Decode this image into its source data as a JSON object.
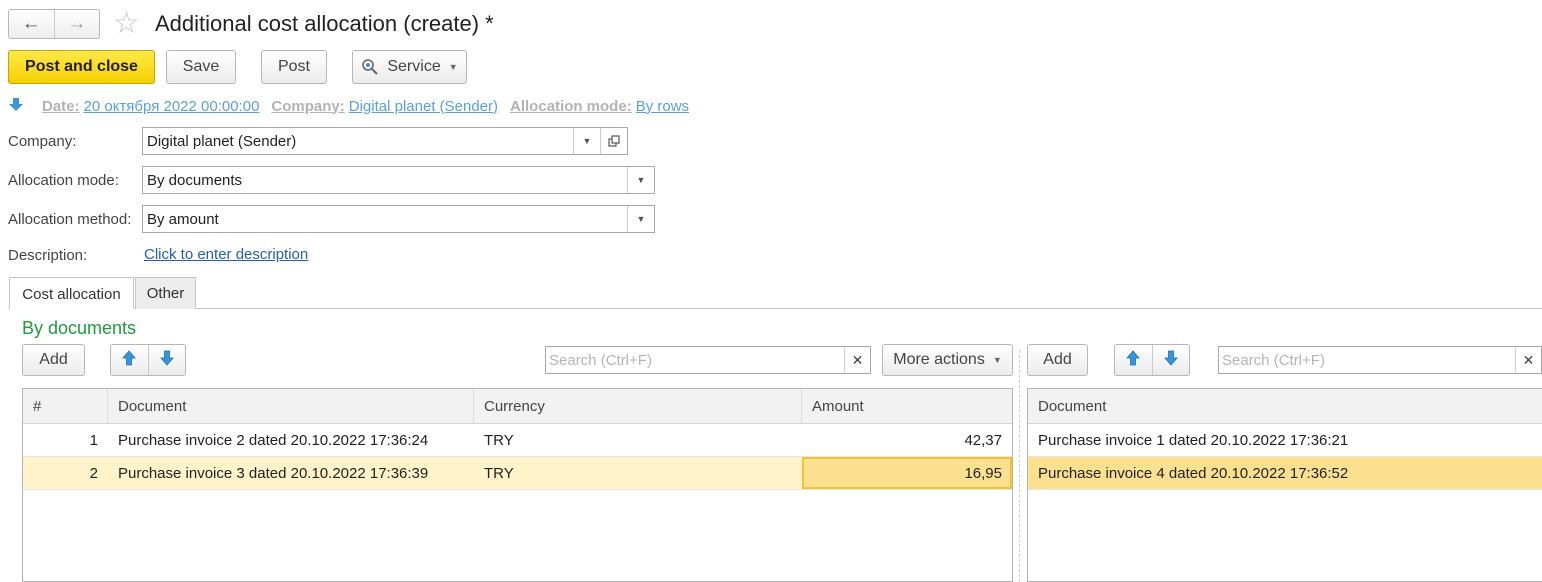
{
  "window": {
    "title": "Additional cost allocation (create) *"
  },
  "icons": {
    "back": "arrow-left-icon",
    "forward": "arrow-right-icon",
    "favorite": "star-icon",
    "service": "magnifier-icon",
    "expand": "arrow-down-icon",
    "move_up": "arrow-up-icon",
    "move_down": "arrow-down-icon",
    "clear": "close-icon",
    "dropdown": "chevron-down-icon",
    "open": "open-window-icon"
  },
  "toolbar": {
    "post_and_close": "Post and close",
    "save": "Save",
    "post": "Post",
    "service": "Service"
  },
  "summary": {
    "date_label": "Date:",
    "date_value": "20 октября 2022 00:00:00",
    "company_label": "Company:",
    "company_value": "Digital planet (Sender)",
    "mode_label": "Allocation mode:",
    "mode_value": "By rows"
  },
  "form": {
    "company_label": "Company:",
    "company_value": "Digital planet (Sender)",
    "allocation_mode_label": "Allocation mode:",
    "allocation_mode_value": "By documents",
    "allocation_method_label": "Allocation method:",
    "allocation_method_value": "By amount",
    "description_label": "Description:",
    "description_link": "Click to enter description"
  },
  "tabs": [
    {
      "label": "Cost allocation",
      "active": true
    },
    {
      "label": "Other",
      "active": false
    }
  ],
  "section_title": "By documents",
  "left_panel": {
    "add_label": "Add",
    "search_placeholder": "Search (Ctrl+F)",
    "more_actions_label": "More actions",
    "columns": [
      "#",
      "Document",
      "Currency",
      "Amount"
    ],
    "rows": [
      {
        "n": "1",
        "document": "Purchase invoice 2 dated 20.10.2022 17:36:24",
        "currency": "TRY",
        "amount": "42,37"
      },
      {
        "n": "2",
        "document": "Purchase invoice 3 dated 20.10.2022 17:36:39",
        "currency": "TRY",
        "amount": "16,95"
      }
    ]
  },
  "right_panel": {
    "add_label": "Add",
    "search_placeholder": "Search (Ctrl+F)",
    "columns": [
      "Document"
    ],
    "rows": [
      {
        "document": "Purchase invoice 1 dated 20.10.2022 17:36:21"
      },
      {
        "document": "Purchase invoice 4 dated 20.10.2022 17:36:52"
      }
    ]
  },
  "colors": {
    "primary_button": "#f4d000",
    "section_title": "#1f9a3a",
    "link": "#245fb3",
    "selected_row": "#fbe18f",
    "arrow_blue": "#3596e0"
  }
}
